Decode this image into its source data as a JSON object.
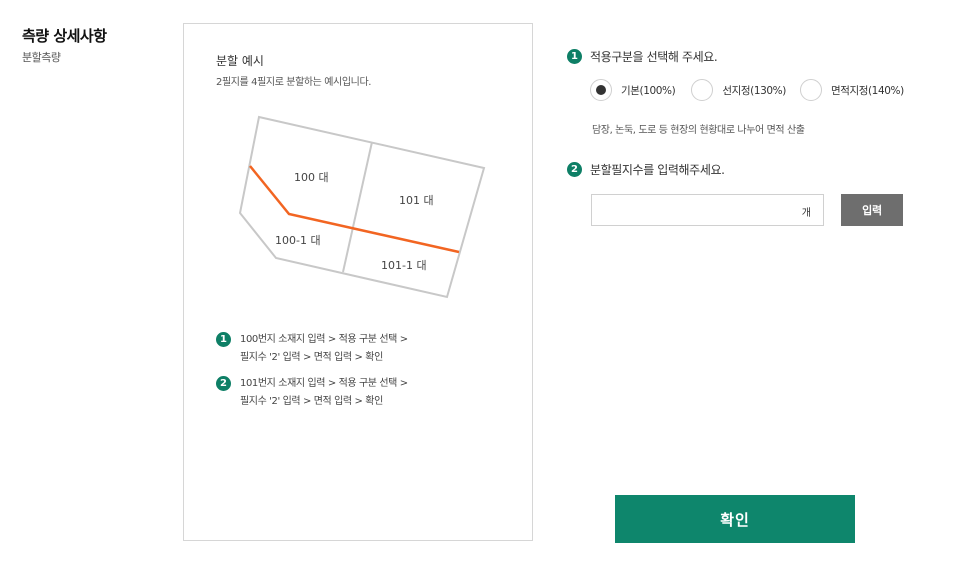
{
  "header": {
    "title": "측량 상세사항",
    "subtitle": "분할측량"
  },
  "example": {
    "title": "분할 예시",
    "description": "2필지를 4필지로 분할하는 예시입니다.",
    "parcels": [
      "100 대",
      "101 대",
      "100-1 대",
      "101-1 대"
    ],
    "steps": [
      {
        "num": "1",
        "line1": "100번지 소재지 입력 > 적용 구분 선택 >",
        "line2": "필지수 '2' 입력 > 면적 입력 > 확인"
      },
      {
        "num": "2",
        "line1": "101번지 소재지 입력 > 적용 구분 선택 >",
        "line2": "필지수 '2' 입력 > 면적 입력 > 확인"
      }
    ]
  },
  "form": {
    "q1": {
      "num": "1",
      "label": "적용구분을 선택해 주세요."
    },
    "options": [
      {
        "label": "기본(100%)",
        "selected": true
      },
      {
        "label": "선지정(130%)",
        "selected": false
      },
      {
        "label": "면적지정(140%)",
        "selected": false
      }
    ],
    "help": "담장, 논둑, 도로 등 현장의 현황대로 나누어 면적 산출",
    "q2": {
      "num": "2",
      "label": "분할필지수를 입력해주세요."
    },
    "count_value": "",
    "unit": "개",
    "enter_label": "입력",
    "confirm_label": "확인"
  },
  "colors": {
    "accent": "#0e866c",
    "badge": "#0e7f66",
    "split_line": "#f26522",
    "parcel_border": "#c8c8c8",
    "enter_button": "#6e6e6e"
  }
}
